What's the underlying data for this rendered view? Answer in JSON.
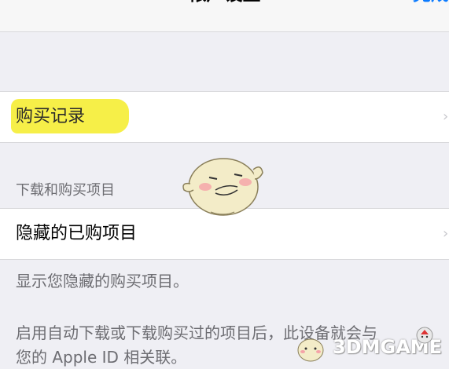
{
  "nav": {
    "title": "帐户设置",
    "done_label": "完成"
  },
  "rows": {
    "purchase_history": "购买记录",
    "hidden_purchases": "隐藏的已购项目"
  },
  "section": {
    "downloads_header": "下载和购买项目"
  },
  "footer": {
    "line1": "显示您隐藏的购买项目。",
    "line2": "启用自动下载或下载购买过的项目后，此设备就会与",
    "line3": "您的 Apple ID 相关联。"
  },
  "watermark": {
    "text": "3DMGAME"
  },
  "colors": {
    "accent": "#0a7aff",
    "highlight": "#f6ee3e",
    "background": "#efeff4"
  }
}
